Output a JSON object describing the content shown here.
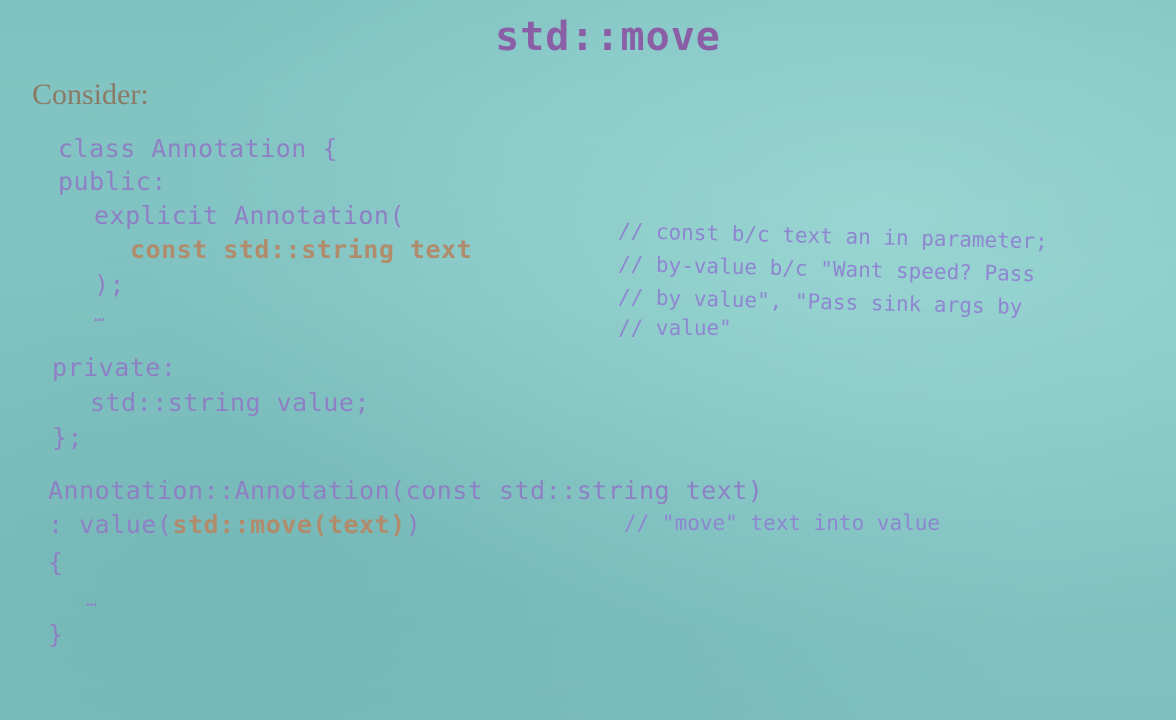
{
  "slide": {
    "title": "std::move",
    "intro": "Consider:"
  },
  "code": {
    "class_decl": "class Annotation {",
    "public_kw": "public:",
    "ctor_decl": "explicit Annotation(",
    "param": "const std::string text",
    "ctor_close": ");",
    "ellipsis_1": "…",
    "private_kw": "private:",
    "member": "std::string value;",
    "class_close": "};",
    "ctor_def": "Annotation::Annotation(const std::string text)",
    "init_prefix": ": value(",
    "init_call": "std::move(text)",
    "init_suffix": ")",
    "brace_open": "{",
    "ellipsis_2": "…",
    "brace_close": "}"
  },
  "comments": {
    "c1": "// const b/c text an in parameter;",
    "c2": "// by-value b/c \"Want speed? Pass",
    "c3": "// by value\", \"Pass sink args by",
    "c4": "// value\"",
    "c5": "// \"move\" text into value"
  }
}
